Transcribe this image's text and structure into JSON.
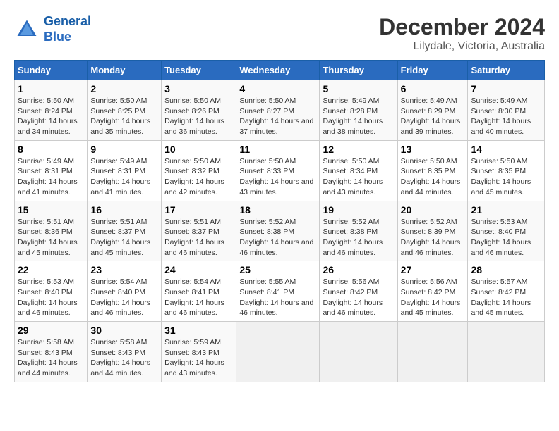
{
  "logo": {
    "line1": "General",
    "line2": "Blue"
  },
  "title": "December 2024",
  "subtitle": "Lilydale, Victoria, Australia",
  "days_header": [
    "Sunday",
    "Monday",
    "Tuesday",
    "Wednesday",
    "Thursday",
    "Friday",
    "Saturday"
  ],
  "weeks": [
    [
      {
        "num": "1",
        "sunrise": "5:50 AM",
        "sunset": "8:24 PM",
        "daylight": "14 hours and 34 minutes."
      },
      {
        "num": "2",
        "sunrise": "5:50 AM",
        "sunset": "8:25 PM",
        "daylight": "14 hours and 35 minutes."
      },
      {
        "num": "3",
        "sunrise": "5:50 AM",
        "sunset": "8:26 PM",
        "daylight": "14 hours and 36 minutes."
      },
      {
        "num": "4",
        "sunrise": "5:50 AM",
        "sunset": "8:27 PM",
        "daylight": "14 hours and 37 minutes."
      },
      {
        "num": "5",
        "sunrise": "5:49 AM",
        "sunset": "8:28 PM",
        "daylight": "14 hours and 38 minutes."
      },
      {
        "num": "6",
        "sunrise": "5:49 AM",
        "sunset": "8:29 PM",
        "daylight": "14 hours and 39 minutes."
      },
      {
        "num": "7",
        "sunrise": "5:49 AM",
        "sunset": "8:30 PM",
        "daylight": "14 hours and 40 minutes."
      }
    ],
    [
      {
        "num": "8",
        "sunrise": "5:49 AM",
        "sunset": "8:31 PM",
        "daylight": "14 hours and 41 minutes."
      },
      {
        "num": "9",
        "sunrise": "5:49 AM",
        "sunset": "8:31 PM",
        "daylight": "14 hours and 41 minutes."
      },
      {
        "num": "10",
        "sunrise": "5:50 AM",
        "sunset": "8:32 PM",
        "daylight": "14 hours and 42 minutes."
      },
      {
        "num": "11",
        "sunrise": "5:50 AM",
        "sunset": "8:33 PM",
        "daylight": "14 hours and 43 minutes."
      },
      {
        "num": "12",
        "sunrise": "5:50 AM",
        "sunset": "8:34 PM",
        "daylight": "14 hours and 43 minutes."
      },
      {
        "num": "13",
        "sunrise": "5:50 AM",
        "sunset": "8:35 PM",
        "daylight": "14 hours and 44 minutes."
      },
      {
        "num": "14",
        "sunrise": "5:50 AM",
        "sunset": "8:35 PM",
        "daylight": "14 hours and 45 minutes."
      }
    ],
    [
      {
        "num": "15",
        "sunrise": "5:51 AM",
        "sunset": "8:36 PM",
        "daylight": "14 hours and 45 minutes."
      },
      {
        "num": "16",
        "sunrise": "5:51 AM",
        "sunset": "8:37 PM",
        "daylight": "14 hours and 45 minutes."
      },
      {
        "num": "17",
        "sunrise": "5:51 AM",
        "sunset": "8:37 PM",
        "daylight": "14 hours and 46 minutes."
      },
      {
        "num": "18",
        "sunrise": "5:52 AM",
        "sunset": "8:38 PM",
        "daylight": "14 hours and 46 minutes."
      },
      {
        "num": "19",
        "sunrise": "5:52 AM",
        "sunset": "8:38 PM",
        "daylight": "14 hours and 46 minutes."
      },
      {
        "num": "20",
        "sunrise": "5:52 AM",
        "sunset": "8:39 PM",
        "daylight": "14 hours and 46 minutes."
      },
      {
        "num": "21",
        "sunrise": "5:53 AM",
        "sunset": "8:40 PM",
        "daylight": "14 hours and 46 minutes."
      }
    ],
    [
      {
        "num": "22",
        "sunrise": "5:53 AM",
        "sunset": "8:40 PM",
        "daylight": "14 hours and 46 minutes."
      },
      {
        "num": "23",
        "sunrise": "5:54 AM",
        "sunset": "8:40 PM",
        "daylight": "14 hours and 46 minutes."
      },
      {
        "num": "24",
        "sunrise": "5:54 AM",
        "sunset": "8:41 PM",
        "daylight": "14 hours and 46 minutes."
      },
      {
        "num": "25",
        "sunrise": "5:55 AM",
        "sunset": "8:41 PM",
        "daylight": "14 hours and 46 minutes."
      },
      {
        "num": "26",
        "sunrise": "5:56 AM",
        "sunset": "8:42 PM",
        "daylight": "14 hours and 46 minutes."
      },
      {
        "num": "27",
        "sunrise": "5:56 AM",
        "sunset": "8:42 PM",
        "daylight": "14 hours and 45 minutes."
      },
      {
        "num": "28",
        "sunrise": "5:57 AM",
        "sunset": "8:42 PM",
        "daylight": "14 hours and 45 minutes."
      }
    ],
    [
      {
        "num": "29",
        "sunrise": "5:58 AM",
        "sunset": "8:43 PM",
        "daylight": "14 hours and 44 minutes."
      },
      {
        "num": "30",
        "sunrise": "5:58 AM",
        "sunset": "8:43 PM",
        "daylight": "14 hours and 44 minutes."
      },
      {
        "num": "31",
        "sunrise": "5:59 AM",
        "sunset": "8:43 PM",
        "daylight": "14 hours and 43 minutes."
      },
      null,
      null,
      null,
      null
    ]
  ]
}
